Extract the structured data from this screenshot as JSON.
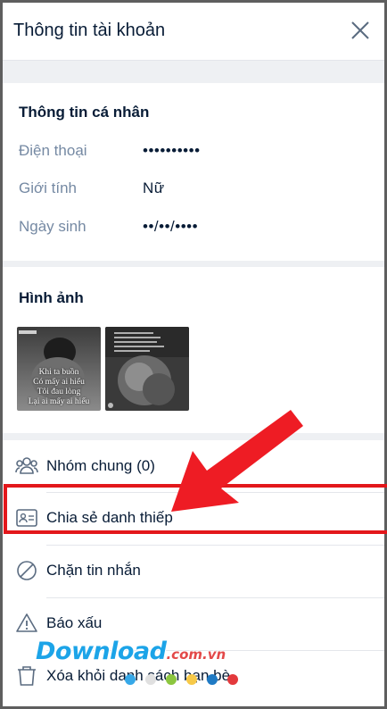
{
  "header": {
    "title": "Thông tin tài khoản",
    "close_icon": "close-icon"
  },
  "personal": {
    "title": "Thông tin cá nhân",
    "rows": [
      {
        "label": "Điện thoại",
        "value": "••••••••••"
      },
      {
        "label": "Giới tính",
        "value": "Nữ"
      },
      {
        "label": "Ngày sinh",
        "value": "••/••/••••"
      }
    ]
  },
  "images": {
    "title": "Hình ảnh",
    "items": [
      {
        "caption_lines": [
          "Khi ta buồn",
          "Có mấy ai hiểu",
          "Tôi đau lòng",
          "Lại ai mấy ai hiểu"
        ]
      },
      {
        "caption_lines": []
      }
    ]
  },
  "actions": [
    {
      "label": "Nhóm chung (0)",
      "icon": "group-icon"
    },
    {
      "label": "Chia sẻ danh thiếp",
      "icon": "contact-card-icon"
    },
    {
      "label": "Chặn tin nhắn",
      "icon": "block-icon"
    },
    {
      "label": "Báo xấu",
      "icon": "warning-icon"
    },
    {
      "label": "Xóa khỏi danh sách bạn bè",
      "icon": "trash-icon"
    }
  ],
  "watermark": {
    "brand": "Download",
    "suffix": ".com.vn",
    "dot_colors": [
      "#36a8e8",
      "#e0e0e0",
      "#8cc63f",
      "#f7c948",
      "#1f7ac4",
      "#e3393c"
    ]
  },
  "colors": {
    "highlight": "#e3171b",
    "text": "#081c36",
    "muted": "#7589a3"
  }
}
